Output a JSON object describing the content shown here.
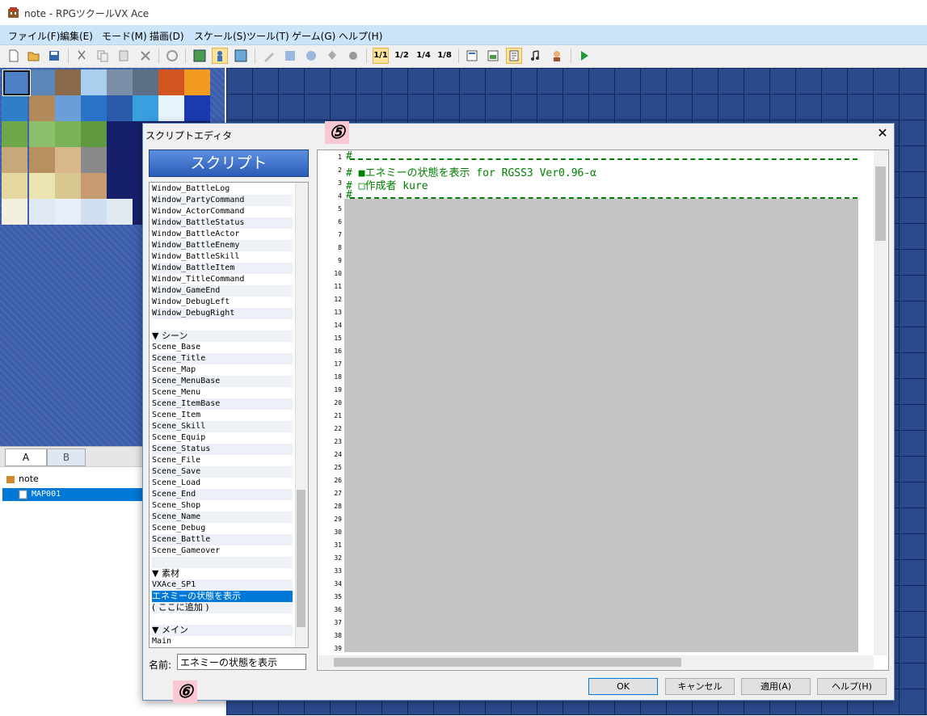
{
  "window": {
    "title": "note - RPGツクールVX Ace"
  },
  "menu": [
    "ファイル(F)",
    "編集(E)",
    "モード(M)",
    "描画(D)",
    "スケール(S)",
    "ツール(T)",
    "ゲーム(G)",
    "ヘルプ(H)"
  ],
  "toolbar": {
    "icons": [
      "new-project-icon",
      "open-project-icon",
      "save-icon",
      "cut-icon",
      "copy-icon",
      "paste-icon",
      "delete-icon",
      "undo-icon",
      "map-layer-icon",
      "event-layer-icon",
      "region-layer-icon",
      "pencil-icon",
      "rectangle-icon",
      "ellipse-icon",
      "fill-icon",
      "shadow-pen-icon",
      "scale-1-1-icon",
      "scale-1-2-icon",
      "scale-1-4-icon",
      "scale-1-8-icon",
      "database-icon",
      "resource-manager-icon",
      "script-editor-icon",
      "sound-test-icon",
      "character-generator-icon",
      "playtest-icon"
    ],
    "scale_labels": [
      "1/1",
      "1/2",
      "1/4",
      "1/8"
    ]
  },
  "palette": {
    "tabs": [
      "A",
      "B"
    ]
  },
  "map_tree": {
    "project": "note",
    "maps": [
      "MAP001"
    ]
  },
  "dialog": {
    "title": "スクリプトエディタ",
    "header": "スクリプト",
    "name_label": "名前:",
    "name_value": "エネミーの状態を表示",
    "buttons": {
      "ok": "OK",
      "cancel": "キャンセル",
      "apply": "適用(A)",
      "help": "ヘルプ(H)"
    }
  },
  "script_list": [
    "Window_BattleLog",
    "Window_PartyCommand",
    "Window_ActorCommand",
    "Window_BattleStatus",
    "Window_BattleActor",
    "Window_BattleEnemy",
    "Window_BattleSkill",
    "Window_BattleItem",
    "Window_TitleCommand",
    "Window_GameEnd",
    "Window_DebugLeft",
    "Window_DebugRight",
    "",
    "▼ シーン",
    "Scene_Base",
    "Scene_Title",
    "Scene_Map",
    "Scene_MenuBase",
    "Scene_Menu",
    "Scene_ItemBase",
    "Scene_Item",
    "Scene_Skill",
    "Scene_Equip",
    "Scene_Status",
    "Scene_File",
    "Scene_Save",
    "Scene_Load",
    "Scene_End",
    "Scene_Shop",
    "Scene_Name",
    "Scene_Debug",
    "Scene_Battle",
    "Scene_Gameover",
    "",
    "▼ 素材",
    "VXAce_SP1",
    "エネミーの状態を表示",
    "( ここに追加 )",
    "",
    "▼ メイン",
    "Main"
  ],
  "selected_script": "エネミーの状態を表示",
  "editor": {
    "line_count": 39,
    "lines": [
      "#==========================================================================",
      "#  ■エネミーの状態を表示 for RGSS3 Ver0.96-α",
      "#  □作成者 kure",
      "#=========================================================================="
    ]
  },
  "markers": [
    "⑤",
    "⑥"
  ]
}
